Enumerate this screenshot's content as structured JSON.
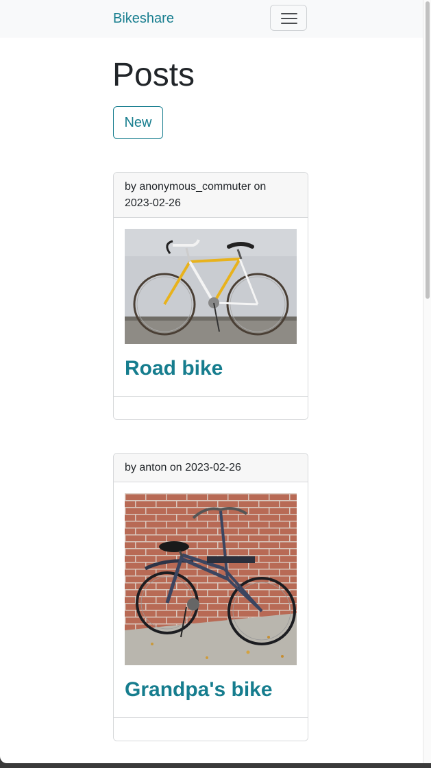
{
  "navbar": {
    "brand": "Bikeshare",
    "toggler_icon": "hamburger-menu-icon"
  },
  "page": {
    "title": "Posts",
    "new_button_label": "New"
  },
  "posts": [
    {
      "byline": "by anonymous_commuter on 2023-02-26",
      "title": "Road bike",
      "image_alt": "Yellow and white road bike leaning against a grey wall"
    },
    {
      "byline": "by anton on 2023-02-26",
      "title": "Grandpa's bike",
      "image_alt": "Dark blue city bike with front rack parked against a brick wall"
    }
  ],
  "colors": {
    "accent": "#167d8e",
    "navbar_bg": "#f8f9fa",
    "text": "#212529",
    "card_border": "#d6d8da"
  }
}
